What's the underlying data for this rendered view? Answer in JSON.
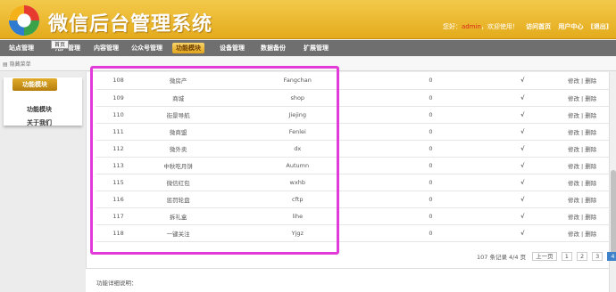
{
  "header": {
    "title": "微信后台管理系统",
    "greeting_prefix": "您好：",
    "username": "admin",
    "greeting_suffix": "，欢迎使用！",
    "links": [
      "访问首页",
      "用户中心",
      "[退出]"
    ]
  },
  "nav": {
    "home_tip": "首页",
    "items": [
      "站点管理",
      "用户管理",
      "内容管理",
      "公众号管理",
      "功能模块",
      "设备管理",
      "数据备份",
      "扩展管理"
    ],
    "active_index": 4
  },
  "subbar": {
    "hide_menu": "隐藏菜单"
  },
  "sidebar": {
    "header": "功能模块",
    "links": [
      "功能模块",
      "关于我们"
    ]
  },
  "table": {
    "rows": [
      {
        "id": "108",
        "name": "微房产",
        "code": "Fangchan",
        "count": "0",
        "flag": "√",
        "actions": "修改 | 删除"
      },
      {
        "id": "109",
        "name": "商城",
        "code": "shop",
        "count": "0",
        "flag": "√",
        "actions": "修改 | 删除"
      },
      {
        "id": "110",
        "name": "街景导航",
        "code": "Jiejing",
        "count": "0",
        "flag": "√",
        "actions": "修改 | 删除"
      },
      {
        "id": "111",
        "name": "微商盟",
        "code": "Fenlei",
        "count": "0",
        "flag": "√",
        "actions": "修改 | 删除"
      },
      {
        "id": "112",
        "name": "微外卖",
        "code": "dx",
        "count": "0",
        "flag": "√",
        "actions": "修改 | 删除"
      },
      {
        "id": "113",
        "name": "中秋吃月饼",
        "code": "Autumn",
        "count": "0",
        "flag": "√",
        "actions": "修改 | 删除"
      },
      {
        "id": "115",
        "name": "微信红包",
        "code": "wxhb",
        "count": "0",
        "flag": "√",
        "actions": "修改 | 删除"
      },
      {
        "id": "116",
        "name": "惩罚轮盘",
        "code": "cftp",
        "count": "0",
        "flag": "√",
        "actions": "修改 | 删除"
      },
      {
        "id": "117",
        "name": "拆礼盒",
        "code": "lihe",
        "count": "0",
        "flag": "√",
        "actions": "修改 | 删除"
      },
      {
        "id": "118",
        "name": "一键关注",
        "code": "Yjgz",
        "count": "0",
        "flag": "√",
        "actions": "修改 | 删除"
      }
    ]
  },
  "pager": {
    "summary": "107 条记录 4/4 页",
    "prev": "上一页",
    "pages": [
      "1",
      "2",
      "3",
      "4"
    ],
    "current_page": "4"
  },
  "help": {
    "label": "功能详细说明："
  },
  "colors": {
    "header_gold": "#e9b327",
    "nav_gray": "#6f6f6f",
    "highlight": "#e23ad9",
    "pager_active": "#3e83c9"
  }
}
